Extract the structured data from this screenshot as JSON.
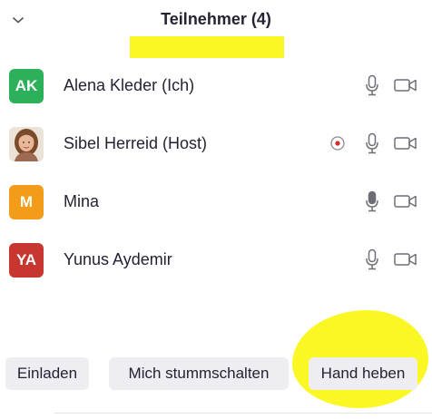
{
  "header": {
    "title": "Teilnehmer (4)",
    "collapse_icon": "chevron-down-icon"
  },
  "participants": [
    {
      "initials": "AK",
      "avatar_color": "#2db05a",
      "name": "Alena Kleder (Ich)",
      "recording": false,
      "mic": "mic-icon",
      "camera": "video-icon"
    },
    {
      "initials": "",
      "avatar_photo": true,
      "name": "Sibel Herreid (Host)",
      "recording": true,
      "mic": "mic-icon",
      "camera": "video-icon"
    },
    {
      "initials": "M",
      "avatar_color": "#f39c1a",
      "name": "Mina",
      "recording": false,
      "mic": "mic-active-icon",
      "camera": "video-icon"
    },
    {
      "initials": "YA",
      "avatar_color": "#c7372f",
      "name": "Yunus Aydemir",
      "recording": false,
      "mic": "mic-icon",
      "camera": "video-icon"
    }
  ],
  "footer": {
    "invite_label": "Einladen",
    "mute_label": "Mich stummschalten",
    "raise_hand_label": "Hand heben"
  },
  "colors": {
    "highlight": "#fbf725",
    "button_bg": "#ededf2",
    "text": "#232333",
    "recording": "#e02828"
  }
}
